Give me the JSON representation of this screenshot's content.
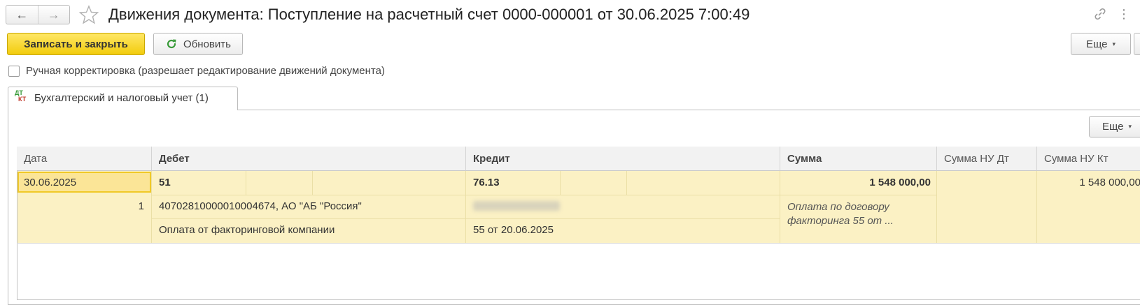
{
  "window": {
    "title": "Движения документа: Поступление на расчетный счет 0000-000001 от 30.06.2025 7:00:49",
    "back_glyph": "←",
    "forward_glyph": "→",
    "more_glyph": "⋮"
  },
  "toolbar": {
    "save_close_label": "Записать и закрыть",
    "refresh_label": "Обновить",
    "more_label": "Еще",
    "caret": "▾"
  },
  "manual_edit": {
    "checked": false,
    "label": "Ручная корректировка (разрешает редактирование движений документа)"
  },
  "tabs": [
    {
      "label": "Бухгалтерский и налоговый учет (1)",
      "icon": "dt-kt-icon",
      "icon_text_top": "ДТ",
      "icon_text_bottom": "КТ"
    }
  ],
  "table_toolbar": {
    "more_label": "Еще"
  },
  "table": {
    "columns": [
      "Дата",
      "Дебет",
      "Кредит",
      "Сумма",
      "Сумма НУ Дт",
      "Сумма НУ Кт"
    ],
    "rows": [
      {
        "date": "30.06.2025",
        "line_number": "1",
        "debit_account": "51",
        "debit_subconto1": "40702810000010004674, АО \"АБ \"Россия\"",
        "debit_subconto2": "Оплата от факторинговой компании",
        "credit_account": "76.13",
        "credit_subconto2": "55 от 20.06.2025",
        "amount": "1 548 000,00",
        "content": "Оплата по договору факторинга 55 от ...",
        "amount_nu_dt": "",
        "amount_nu_kt": "1 548 000,00"
      }
    ]
  },
  "colors": {
    "primary_button": "#f2cc0c",
    "row_highlight": "#fbf1c4",
    "selected_cell_border": "#f0c928",
    "refresh_icon": "#3a9b3a"
  }
}
